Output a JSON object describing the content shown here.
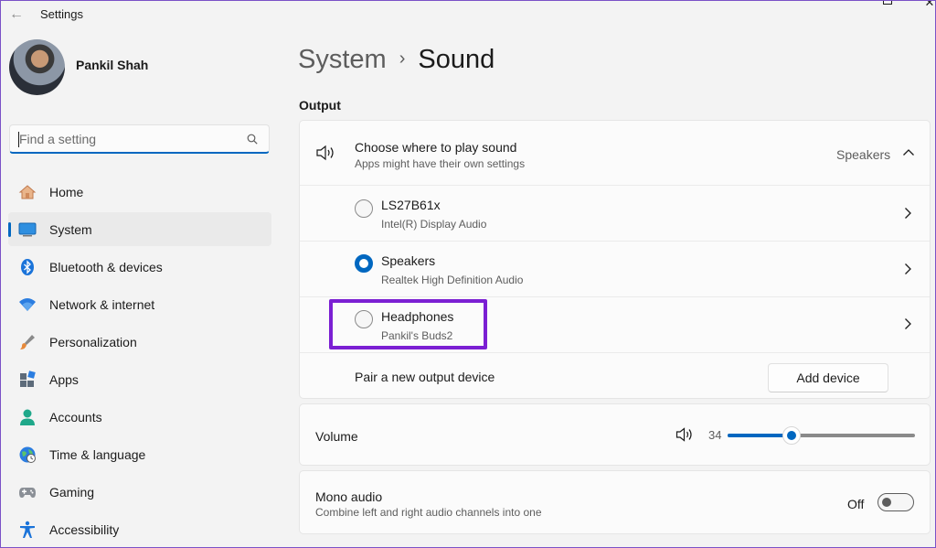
{
  "window": {
    "title": "Settings",
    "back_icon": "back-arrow-icon"
  },
  "profile": {
    "name": "Pankil Shah"
  },
  "search": {
    "placeholder": "Find a setting",
    "icon": "search-icon"
  },
  "sidebar": {
    "items": [
      {
        "label": "Home",
        "icon": "home-icon",
        "active": false
      },
      {
        "label": "System",
        "icon": "system-icon",
        "active": true
      },
      {
        "label": "Bluetooth & devices",
        "icon": "bluetooth-icon",
        "active": false
      },
      {
        "label": "Network & internet",
        "icon": "wifi-icon",
        "active": false
      },
      {
        "label": "Personalization",
        "icon": "brush-icon",
        "active": false
      },
      {
        "label": "Apps",
        "icon": "apps-icon",
        "active": false
      },
      {
        "label": "Accounts",
        "icon": "accounts-icon",
        "active": false
      },
      {
        "label": "Time & language",
        "icon": "globe-clock-icon",
        "active": false
      },
      {
        "label": "Gaming",
        "icon": "gamepad-icon",
        "active": false
      },
      {
        "label": "Accessibility",
        "icon": "accessibility-icon",
        "active": false
      }
    ]
  },
  "breadcrumb": {
    "parent": "System",
    "separator": "›",
    "current": "Sound"
  },
  "output": {
    "section_label": "Output",
    "header": {
      "title": "Choose where to play sound",
      "subtitle": "Apps might have their own settings",
      "selected_value": "Speakers"
    },
    "devices": [
      {
        "name": "LS27B61x",
        "description": "Intel(R) Display Audio",
        "selected": false
      },
      {
        "name": "Speakers",
        "description": "Realtek High Definition Audio",
        "selected": true
      },
      {
        "name": "Headphones",
        "description": "Pankil's Buds2",
        "selected": false
      }
    ],
    "pair": {
      "label": "Pair a new output device",
      "button": "Add device"
    }
  },
  "volume": {
    "label": "Volume",
    "value": "34",
    "level_percent": 34
  },
  "mono_audio": {
    "title": "Mono audio",
    "subtitle": "Combine left and right audio channels into one",
    "state_label": "Off",
    "on": false
  },
  "colors": {
    "accent": "#0067c0",
    "highlight_box": "#7b1fd3"
  }
}
